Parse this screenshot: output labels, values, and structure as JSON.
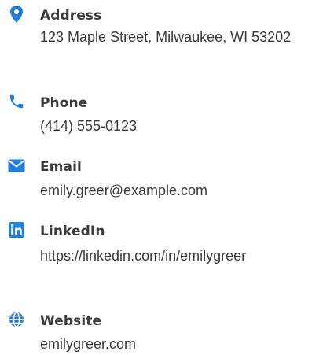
{
  "contact": {
    "accent_color": "#1e7fe0",
    "items": [
      {
        "icon": "location-pin-icon",
        "label": "Address",
        "value": "123 Maple Street, Milwaukee, WI 53202"
      },
      {
        "icon": "phone-icon",
        "label": "Phone",
        "value": "(414) 555-0123"
      },
      {
        "icon": "envelope-icon",
        "label": "Email",
        "value": "emily.greer@example.com"
      },
      {
        "icon": "linkedin-icon",
        "label": "LinkedIn",
        "value": "https://linkedin.com/in/emilygreer"
      },
      {
        "icon": "globe-icon",
        "label": "Website",
        "value": "emilygreer.com"
      }
    ]
  }
}
